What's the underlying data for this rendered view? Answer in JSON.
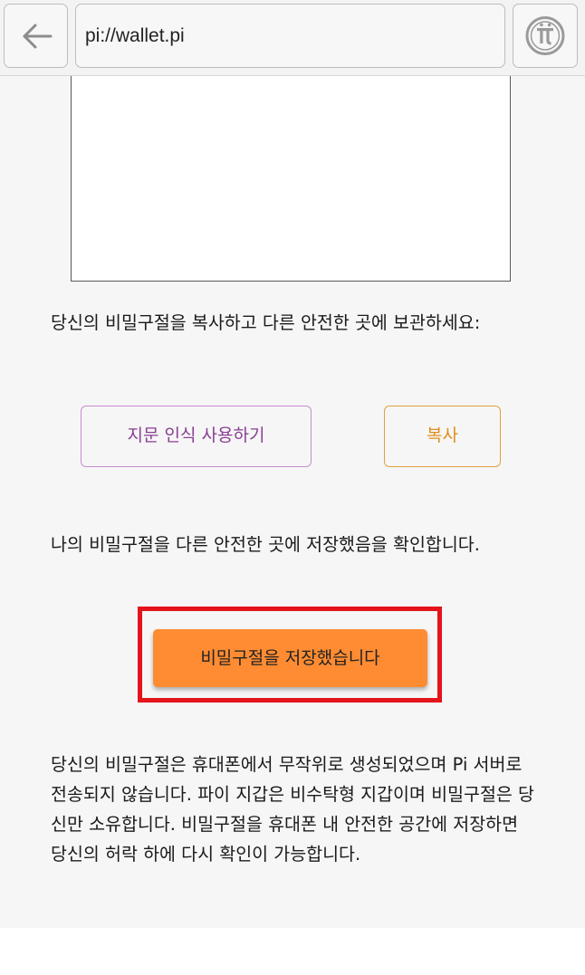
{
  "browser": {
    "url": "pi://wallet.pi",
    "back_icon": "arrow-left-icon",
    "pi_icon": "pi-logo-icon"
  },
  "main": {
    "copy_instruction": "당신의 비밀구절을 복사하고 다른 안전한 곳에 보관하세요:",
    "fingerprint_button": "지문 인식 사용하기",
    "copy_button": "복사",
    "confirm_text": "나의 비밀구절을 다른 안전한 곳에 저장했음을 확인합니다.",
    "saved_button": "비밀구절을 저장했습니다",
    "info_text": "당신의 비밀구절은 휴대폰에서 무작위로 생성되었으며 Pi 서버로 전송되지 않습니다. 파이 지갑은 비수탁형 지갑이며 비밀구절은 당신만 소유합니다. 비밀구절을 휴대폰 내 안전한 공간에 저장하면 당신의 허락 하에 다시 확인이 가능합니다."
  },
  "colors": {
    "accent_orange": "#ff8c32",
    "fingerprint_purple": "#8a3f93",
    "copy_orange": "#e08f1b",
    "highlight_red": "#e3141c"
  }
}
